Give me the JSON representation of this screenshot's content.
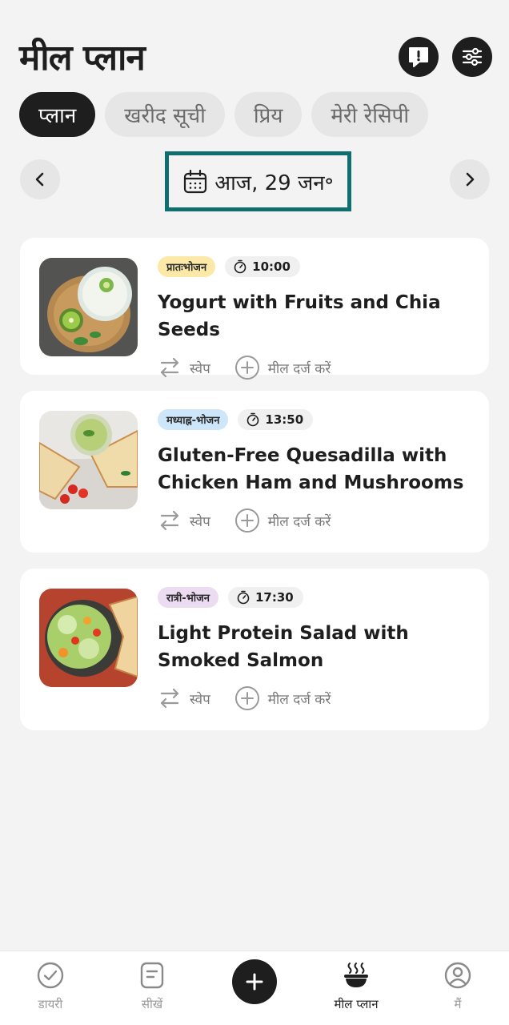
{
  "header": {
    "title": "मील प्लान",
    "feedback_icon": "feedback-icon",
    "settings_icon": "sliders-icon"
  },
  "tabs": [
    {
      "label": "प्लान",
      "active": true
    },
    {
      "label": "खरीद सूची",
      "active": false
    },
    {
      "label": "प्रिय",
      "active": false
    },
    {
      "label": "मेरी रेसिपी",
      "active": false
    }
  ],
  "date_nav": {
    "date_label": "आज, 29 जन॰",
    "prev_icon": "chevron-left-icon",
    "next_icon": "chevron-right-icon",
    "highlight_color": "#0f6f6f"
  },
  "meals": [
    {
      "badge": "प्रातःभोजन",
      "badge_color": "#fde9a7",
      "time": "10:00",
      "title": "Yogurt with Fruits and Chia Seeds",
      "swap_label": "स्वेप",
      "log_label": "मील दर्ज करें"
    },
    {
      "badge": "मध्याह्न-भोजन",
      "badge_color": "#cde6f9",
      "time": "13:50",
      "title": "Gluten-Free Quesadilla with Chicken Ham and Mushrooms",
      "swap_label": "स्वेप",
      "log_label": "मील दर्ज करें"
    },
    {
      "badge": "रात्री-भोजन",
      "badge_color": "#ecdcf2",
      "time": "17:30",
      "title": "Light Protein Salad with Smoked Salmon",
      "swap_label": "स्वेप",
      "log_label": "मील दर्ज करें"
    }
  ],
  "bottom_nav": {
    "items": [
      {
        "label": "डायरी",
        "icon": "check-circle-icon",
        "active": false
      },
      {
        "label": "सीखें",
        "icon": "document-icon",
        "active": false
      },
      {
        "label": "मील प्लान",
        "icon": "bowl-icon",
        "active": true
      },
      {
        "label": "मैं",
        "icon": "profile-icon",
        "active": false
      }
    ],
    "add_icon": "plus-icon"
  }
}
